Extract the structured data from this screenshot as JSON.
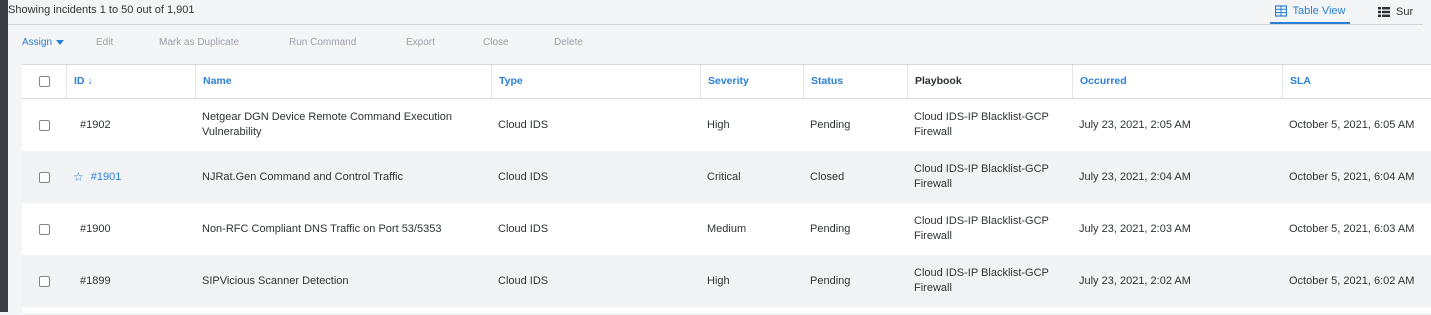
{
  "header": {
    "count_text": "Showing incidents 1 to 50 out of 1,901",
    "table_view_label": "Table View",
    "summary_view_label": "Sur"
  },
  "toolbar": {
    "assign": "Assign",
    "edit": "Edit",
    "duplicate": "Mark as Duplicate",
    "run": "Run Command",
    "export": "Export",
    "close": "Close",
    "delete": "Delete"
  },
  "table": {
    "columns": {
      "id": "ID ↓",
      "name": "Name",
      "type": "Type",
      "severity": "Severity",
      "status": "Status",
      "playbook": "Playbook",
      "occurred": "Occurred",
      "sla": "SLA"
    },
    "rows": [
      {
        "id": "#1902",
        "starred": false,
        "name_line1": "Netgear DGN Device Remote Command Execution",
        "name_line2": "Vulnerability",
        "type": "Cloud IDS",
        "severity": "High",
        "status": "Pending",
        "playbook_line1": "Cloud IDS-IP Blacklist-GCP",
        "playbook_line2": "Firewall",
        "occurred": "July 23, 2021, 2:05 AM",
        "sla": "October 5, 2021, 6:05 AM"
      },
      {
        "id": "#1901",
        "starred": true,
        "name_line1": "NJRat.Gen Command and Control Traffic",
        "name_line2": "",
        "type": "Cloud IDS",
        "severity": "Critical",
        "status": "Closed",
        "playbook_line1": "Cloud IDS-IP Blacklist-GCP",
        "playbook_line2": "Firewall",
        "occurred": "July 23, 2021, 2:04 AM",
        "sla": "October 5, 2021, 6:04 AM"
      },
      {
        "id": "#1900",
        "starred": false,
        "name_line1": "Non-RFC Compliant DNS Traffic on Port 53/5353",
        "name_line2": "",
        "type": "Cloud IDS",
        "severity": "Medium",
        "status": "Pending",
        "playbook_line1": "Cloud IDS-IP Blacklist-GCP",
        "playbook_line2": "Firewall",
        "occurred": "July 23, 2021, 2:03 AM",
        "sla": "October 5, 2021, 6:03 AM"
      },
      {
        "id": "#1899",
        "starred": false,
        "name_line1": "SIPVicious Scanner Detection",
        "name_line2": "",
        "type": "Cloud IDS",
        "severity": "High",
        "status": "Pending",
        "playbook_line1": "Cloud IDS-IP Blacklist-GCP",
        "playbook_line2": "Firewall",
        "occurred": "July 23, 2021, 2:02 AM",
        "sla": "October 5, 2021, 6:02 AM"
      }
    ]
  },
  "colors": {
    "accent": "#2b7fd6",
    "row_alt": "#f2f3f4",
    "page_bg": "#f4f5f6"
  },
  "icons": {
    "table_view": "table-grid-icon",
    "summary_view": "list-icon",
    "sort": "arrow-down-icon",
    "star": "star-outline-icon"
  }
}
